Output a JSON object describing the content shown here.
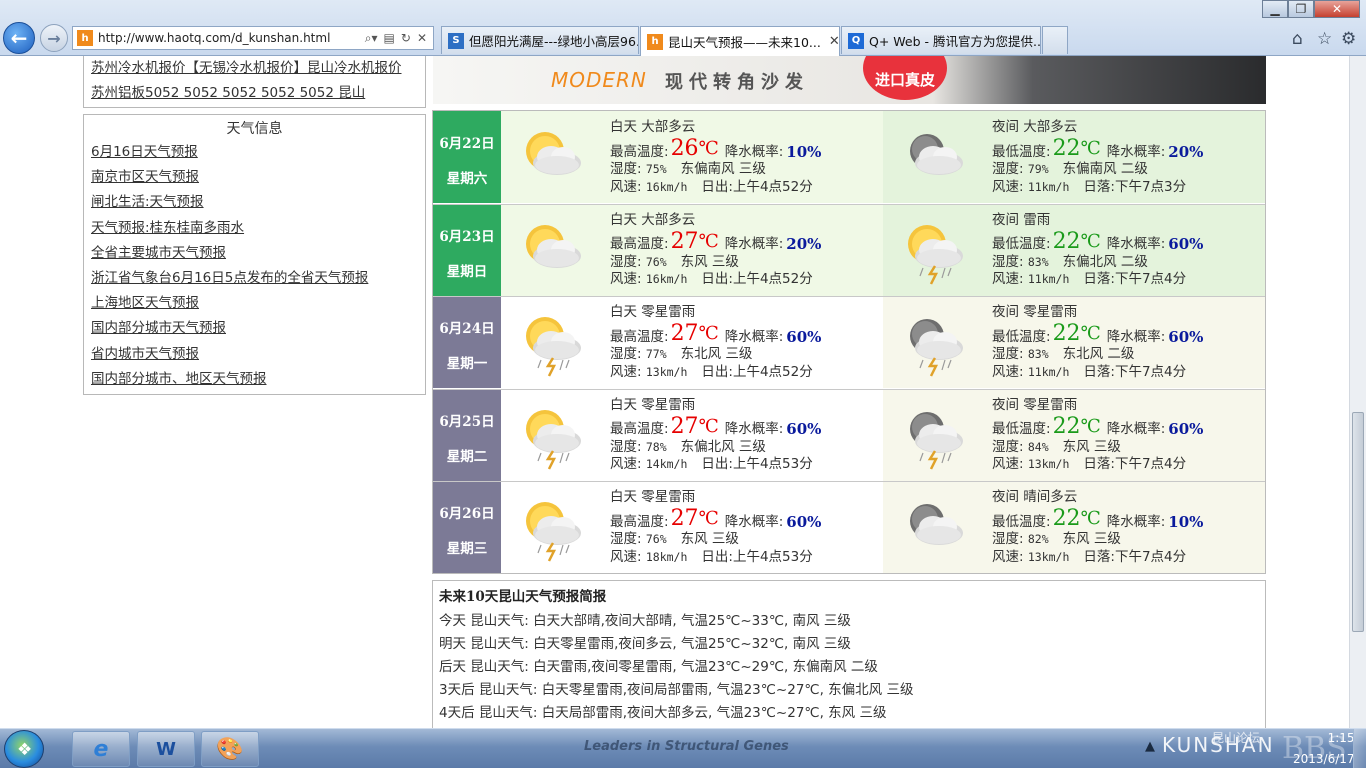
{
  "browser": {
    "url": "http://www.haotq.com/d_kunshan.html",
    "tabs": [
      {
        "label": "但愿阳光满屋---绿地小高层96...",
        "active": false
      },
      {
        "label": "昆山天气预报——未来10...",
        "active": true
      },
      {
        "label": "Q+ Web - 腾讯官方为您提供...",
        "active": false
      }
    ],
    "site_icon": "h",
    "qq_icon": "Q"
  },
  "left_top_links": [
    "苏州冷水机报价【无锡冷水机报价】昆山冷水机报价",
    "苏州铝板5052 5052 5052 5052 5052 昆山"
  ],
  "weather_info": {
    "title": "天气信息",
    "links": [
      "6月16日天气预报",
      "南京市区天气预报",
      "闸北生活:天气预报",
      "天气预报:桂东桂南多雨水",
      "全省主要城市天气预报",
      "浙江省气象台6月16日5点发布的全省天气预报",
      "上海地区天气预报",
      "国内部分城市天气预报",
      "省内城市天气预报",
      "国内部分城市、地区天气预报"
    ]
  },
  "ad": {
    "modern": "MODERN",
    "cn": "现代转角沙发",
    "seal": "进口真皮"
  },
  "labels": {
    "max_temp": "最高温度:",
    "min_temp": "最低温度:",
    "pop": "降水概率:",
    "humidity": "湿度:",
    "wind_speed": "风速:",
    "sunrise": "日出:",
    "sunset": "日落:",
    "unit": "℃"
  },
  "days": [
    {
      "date": "6月22日",
      "weekday": "星期六",
      "date_color": "#2eaa60",
      "day": {
        "cond": "白天 大部多云",
        "temp": "26",
        "pop": "10%",
        "humidity": "75%",
        "wind_dir": "东偏南风 三级",
        "wind_speed": "16km/h",
        "sun": "上午4点52分",
        "icon": "partly-cloudy-day-icon"
      },
      "night": {
        "cond": "夜间 大部多云",
        "temp": "22",
        "pop": "20%",
        "humidity": "79%",
        "wind_dir": "东偏南风 二级",
        "wind_speed": "11km/h",
        "sun": "下午7点3分",
        "icon": "partly-cloudy-night-icon"
      },
      "bg_day": "#f0f9e6",
      "bg_night": "#e4f3dc"
    },
    {
      "date": "6月23日",
      "weekday": "星期日",
      "date_color": "#2eaa60",
      "day": {
        "cond": "白天 大部多云",
        "temp": "27",
        "pop": "20%",
        "humidity": "76%",
        "wind_dir": "东风 三级",
        "wind_speed": "16km/h",
        "sun": "上午4点52分",
        "icon": "partly-cloudy-day-icon"
      },
      "night": {
        "cond": "夜间 雷雨",
        "temp": "22",
        "pop": "60%",
        "humidity": "83%",
        "wind_dir": "东偏北风 二级",
        "wind_speed": "11km/h",
        "sun": "下午7点4分",
        "icon": "thunderstorm-icon"
      },
      "bg_day": "#f0f9e6",
      "bg_night": "#e4f3dc"
    },
    {
      "date": "6月24日",
      "weekday": "星期一",
      "date_color": "#7c7a96",
      "day": {
        "cond": "白天 零星雷雨",
        "temp": "27",
        "pop": "60%",
        "humidity": "77%",
        "wind_dir": "东北风 三级",
        "wind_speed": "13km/h",
        "sun": "上午4点52分",
        "icon": "scattered-thunder-day-icon"
      },
      "night": {
        "cond": "夜间 零星雷雨",
        "temp": "22",
        "pop": "60%",
        "humidity": "83%",
        "wind_dir": "东北风 二级",
        "wind_speed": "11km/h",
        "sun": "下午7点4分",
        "icon": "scattered-thunder-night-icon"
      },
      "bg_day": "#ffffff",
      "bg_night": "#f7f7eb"
    },
    {
      "date": "6月25日",
      "weekday": "星期二",
      "date_color": "#7c7a96",
      "day": {
        "cond": "白天 零星雷雨",
        "temp": "27",
        "pop": "60%",
        "humidity": "78%",
        "wind_dir": "东偏北风 三级",
        "wind_speed": "14km/h",
        "sun": "上午4点53分",
        "icon": "scattered-thunder-day-icon"
      },
      "night": {
        "cond": "夜间 零星雷雨",
        "temp": "22",
        "pop": "60%",
        "humidity": "84%",
        "wind_dir": "东风 三级",
        "wind_speed": "13km/h",
        "sun": "下午7点4分",
        "icon": "scattered-thunder-night-icon"
      },
      "bg_day": "#ffffff",
      "bg_night": "#f7f7eb"
    },
    {
      "date": "6月26日",
      "weekday": "星期三",
      "date_color": "#7c7a96",
      "day": {
        "cond": "白天 零星雷雨",
        "temp": "27",
        "pop": "60%",
        "humidity": "76%",
        "wind_dir": "东风 三级",
        "wind_speed": "18km/h",
        "sun": "上午4点53分",
        "icon": "scattered-thunder-day-icon"
      },
      "night": {
        "cond": "夜间 晴间多云",
        "temp": "22",
        "pop": "10%",
        "humidity": "82%",
        "wind_dir": "东风 三级",
        "wind_speed": "13km/h",
        "sun": "下午7点4分",
        "icon": "partly-cloudy-night-icon"
      },
      "bg_day": "#ffffff",
      "bg_night": "#f7f7eb"
    }
  ],
  "summary": {
    "title": "未来10天昆山天气预报简报",
    "lines": [
      "今天 昆山天气: 白天大部晴,夜间大部晴, 气温25℃~33℃, 南风 三级",
      "明天 昆山天气: 白天零星雷雨,夜间多云, 气温25℃~32℃, 南风 三级",
      "后天 昆山天气: 白天雷雨,夜间零星雷雨, 气温23℃~29℃, 东偏南风 二级",
      "3天后 昆山天气: 白天零星雷雨,夜间局部雷雨, 气温23℃~27℃, 东偏北风 三级",
      "4天后 昆山天气: 白天局部雷雨,夜间大部多云, 气温23℃~27℃, 东风 三级"
    ]
  },
  "taskbar": {
    "bg_text": "Leaders in Structural Genes",
    "brand": "KUNSHAN",
    "brand_cn": "昆山论坛",
    "brand_bbs": "BBS",
    "time": "1:15",
    "date": "2013/6/17"
  }
}
